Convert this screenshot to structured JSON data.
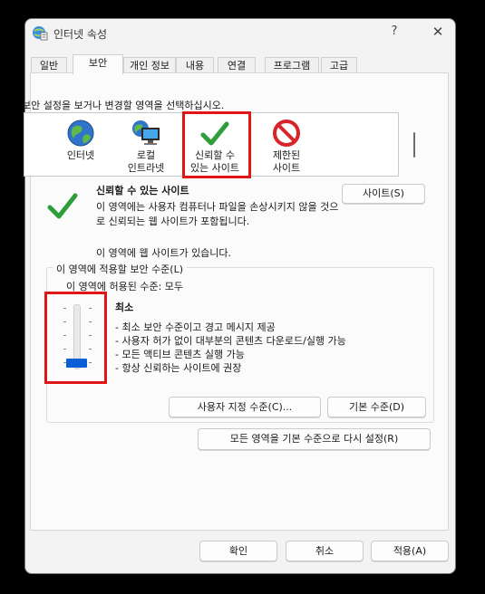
{
  "window": {
    "title": "인터넷 속성",
    "help_glyph": "?",
    "close_glyph": "✕"
  },
  "tabs": [
    "일반",
    "보안",
    "개인 정보",
    "내용",
    "연결",
    "프로그램",
    "고급"
  ],
  "active_tab": "보안",
  "security": {
    "select_zone_text": "보안 설정을 보거나 변경할 영역을 선택하십시오.",
    "zones": [
      {
        "label_line1": "인터넷",
        "label_line2": "",
        "icon": "globe-icon"
      },
      {
        "label_line1": "로컬",
        "label_line2": "인트라넷",
        "icon": "intranet-computer-icon"
      },
      {
        "label_line1": "신뢰할 수",
        "label_line2": "있는 사이트",
        "icon": "checkmark-icon"
      },
      {
        "label_line1": "제한된",
        "label_line2": "사이트",
        "icon": "restricted-icon"
      }
    ],
    "selected_zone": "신뢰할 수 있는 사이트",
    "zone_title": "신뢰할 수 있는 사이트",
    "zone_description": "이 영역에는 사용자 컴퓨터나 파일을 손상시키지 않을 것으로 신뢰되는 웹 사이트가 포함됩니다.",
    "zone_note": "이 영역에 웹 사이트가 있습니다.",
    "sites_button": "사이트(S)",
    "group_label": "이 영역에 적용할 보안 수준(L)",
    "allowed_levels": "이 영역에 허용된 수준: 모두",
    "level_title": "최소",
    "level_lines": [
      "- 최소 보안 수준이고 경고 메시지 제공",
      "- 사용자 허가 없이 대부분의 콘텐츠 다운로드/실행 가능",
      "- 모든 액티브 콘텐츠 실행 가능",
      "- 항상 신뢰하는 사이트에 권장"
    ],
    "slider_level": 0,
    "custom_level_button": "사용자 지정 수준(C)...",
    "default_level_button": "기본 수준(D)",
    "reset_all_button": "모든 영역을 기본 수준으로 다시 설정(R)"
  },
  "footer": {
    "ok_button": "확인",
    "cancel_button": "취소",
    "apply_button": "적용(A)"
  },
  "colors": {
    "highlight_border": "#e01515",
    "slider_thumb": "#0a5fd6",
    "check_green": "#2e9d3a",
    "restricted_red": "#d9242c"
  }
}
